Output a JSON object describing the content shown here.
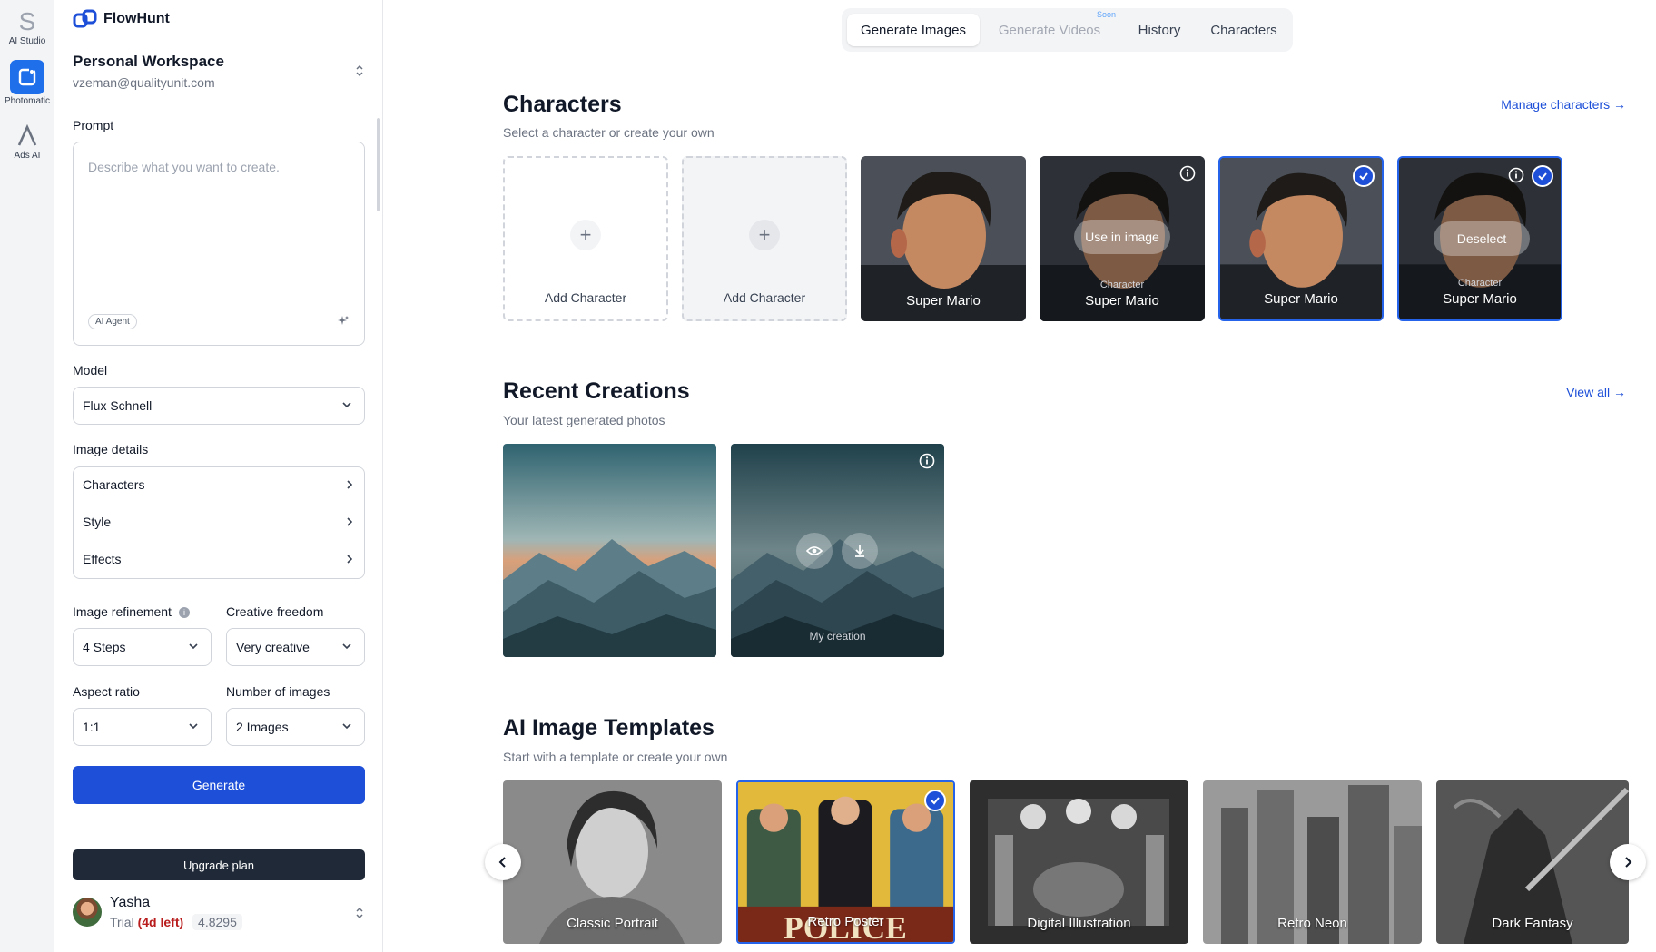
{
  "rail": {
    "items": [
      {
        "label": "AI Studio",
        "icon": "studio-s-icon"
      },
      {
        "label": "Photomatic",
        "icon": "photomatic-icon",
        "active": true
      },
      {
        "label": "Ads AI",
        "icon": "ads-ai-icon"
      }
    ]
  },
  "sidebar": {
    "brand": "FlowHunt",
    "workspace": {
      "title": "Personal Workspace",
      "email": "vzeman@qualityunit.com"
    },
    "prompt": {
      "label": "Prompt",
      "placeholder": "Describe what you want to create.",
      "chip": "AI Agent"
    },
    "model": {
      "label": "Model",
      "value": "Flux Schnell"
    },
    "image_details": {
      "label": "Image details",
      "rows": [
        "Characters",
        "Style",
        "Effects"
      ]
    },
    "refinement": {
      "label": "Image refinement",
      "value": "4 Steps"
    },
    "freedom": {
      "label": "Creative freedom",
      "value": "Very creative"
    },
    "aspect": {
      "label": "Aspect ratio",
      "value": "1:1"
    },
    "count": {
      "label": "Number of images",
      "value": "2 Images"
    },
    "generate_label": "Generate",
    "upgrade_label": "Upgrade plan",
    "user": {
      "name": "Yasha",
      "trial": "Trial",
      "days": "(4d left)",
      "credits": "4.8295"
    }
  },
  "tabs": [
    {
      "label": "Generate Images",
      "state": "active"
    },
    {
      "label": "Generate Videos",
      "state": "disabled",
      "badge": "Soon"
    },
    {
      "label": "History",
      "state": "normal"
    },
    {
      "label": "Characters",
      "state": "normal"
    }
  ],
  "characters": {
    "title": "Characters",
    "subtitle": "Select a character or create your own",
    "link": "Manage characters →",
    "add_label": "Add Character",
    "cards": [
      {
        "name": "Super Mario"
      },
      {
        "name": "Super Mario",
        "kicker": "Character",
        "pill": "Use in image"
      },
      {
        "name": "Super Mario"
      },
      {
        "name": "Super Mario",
        "kicker": "Character",
        "pill": "Deselect"
      }
    ]
  },
  "recent": {
    "title": "Recent Creations",
    "subtitle": "Your latest generated photos",
    "link": "View all →",
    "items": [
      {
        "caption": ""
      },
      {
        "caption": "My creation"
      }
    ]
  },
  "templates": {
    "title": "AI Image Templates",
    "subtitle": "Start with a template or create your own",
    "items": [
      "Classic Portrait",
      "Retro Poster",
      "Digital Illustration",
      "Retro Neon",
      "Dark Fantasy"
    ],
    "poster_text": "POLICE"
  },
  "colors": {
    "accent": "#1d4fd8",
    "dark": "#1f2937",
    "trial_red": "#b91c1c"
  }
}
